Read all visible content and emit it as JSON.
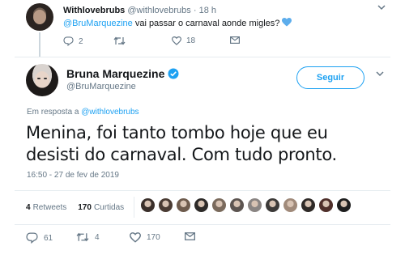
{
  "parent_tweet": {
    "name": "Withlovebrubs",
    "handle": "@withlovebrubs",
    "time": "· 18 h",
    "mention": "@BruMarquezine",
    "text": " vai passar o carnaval aonde migles?",
    "replies": "2",
    "retweets": "",
    "likes": "18"
  },
  "main_tweet": {
    "name": "Bruna Marquezine",
    "verified": true,
    "handle": "@BruMarquezine",
    "follow_label": "Seguir",
    "reply_prefix": "Em resposta a",
    "reply_mention": "@withlovebrubs",
    "text": "Menina, foi tanto tombo hoje que eu desisti do carnaval. Com tudo pronto.",
    "timestamp": "16:50 - 27 de fev de 2019",
    "retweets_count": "4",
    "retweets_label": "Retweets",
    "likes_count": "170",
    "likes_label": "Curtidas",
    "reply_count": "61",
    "retweet_count": "4",
    "like_count": "170"
  },
  "colors": {
    "accent": "#1da1f2",
    "text": "#14171a",
    "muted": "#657786",
    "heart_emoji": "#5dadec"
  },
  "liker_avatars": [
    "#3a2f2a",
    "#4a3b33",
    "#6e5b4d",
    "#2d2a28",
    "#7a6a5c",
    "#5c5450",
    "#8a8583",
    "#3c3a38",
    "#a08a7a",
    "#2f2a27",
    "#4f2f2a",
    "#1e1e1e"
  ]
}
